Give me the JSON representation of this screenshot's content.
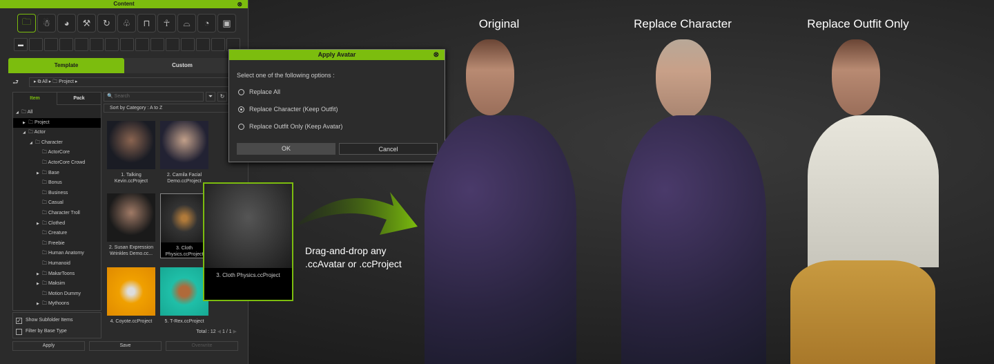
{
  "panel": {
    "title": "Content",
    "close_icon": "close-circle-icon",
    "category_icons": [
      "folder-icon",
      "actor-icon",
      "morph-icon",
      "tools-icon",
      "motion-icon",
      "cloth-icon",
      "accessory-icon",
      "pose-icon",
      "stage-icon",
      "scene-icon",
      "material-icon"
    ],
    "tabs": [
      "Template",
      "Custom"
    ],
    "breadcrumb": [
      "All",
      "Project"
    ],
    "tree_tabs": [
      "Item",
      "Pack"
    ],
    "tree": [
      {
        "label": "All",
        "level": 0,
        "arrow": "down"
      },
      {
        "label": "Project",
        "level": 1,
        "arrow": "right",
        "selected": true
      },
      {
        "label": "Actor",
        "level": 1,
        "arrow": "down"
      },
      {
        "label": "Character",
        "level": 2,
        "arrow": "down"
      },
      {
        "label": "ActorCore",
        "level": 3
      },
      {
        "label": "ActorCore Crowd",
        "level": 3
      },
      {
        "label": "Base",
        "level": 3,
        "arrow": "right"
      },
      {
        "label": "Bonus",
        "level": 3
      },
      {
        "label": "Business",
        "level": 3
      },
      {
        "label": "Casual",
        "level": 3
      },
      {
        "label": "Character Troll",
        "level": 3
      },
      {
        "label": "Clothed",
        "level": 3,
        "arrow": "right"
      },
      {
        "label": "Creature",
        "level": 3
      },
      {
        "label": "Freebie",
        "level": 3
      },
      {
        "label": "Human Anatomy",
        "level": 3
      },
      {
        "label": "Humanoid",
        "level": 3
      },
      {
        "label": "MakarToons",
        "level": 3,
        "arrow": "right"
      },
      {
        "label": "Maksim",
        "level": 3,
        "arrow": "right"
      },
      {
        "label": "Motion Dummy",
        "level": 3
      },
      {
        "label": "Mythoons",
        "level": 3,
        "arrow": "right"
      }
    ],
    "options": [
      {
        "label": "Show Subfolder Items",
        "checked": true
      },
      {
        "label": "Filter by Base Type",
        "checked": false
      }
    ],
    "search_placeholder": "Search",
    "sort": "Sort by Category : A to Z",
    "thumbnails": [
      {
        "line1": "1. Talking",
        "line2": "Kevin.ccProject"
      },
      {
        "line1": "2. Camila Facial",
        "line2": "Demo.ccProject"
      },
      {
        "line1": "2. Susan Expression",
        "line2": "Wrinkles Demo.cc..."
      },
      {
        "line1": "3. Cloth",
        "line2": "Physics.ccProject"
      },
      {
        "line1": "4. Coyote.ccProject",
        "line2": ""
      },
      {
        "line1": "5. T-Rex.ccProject",
        "line2": ""
      }
    ],
    "total": "Total : 12",
    "page": "1",
    "pages": "1",
    "buttons": {
      "apply": "Apply",
      "save": "Save",
      "overwrite": "Overwrite"
    }
  },
  "dialog": {
    "title": "Apply Avatar",
    "prompt": "Select one of the following options :",
    "options": [
      "Replace All",
      "Replace Character (Keep Outfit)",
      "Replace Outfit Only (Keep Avatar)"
    ],
    "selected_index": 1,
    "ok": "OK",
    "cancel": "Cancel"
  },
  "drag_preview": {
    "caption": "3. Cloth Physics.ccProject"
  },
  "drag_text": {
    "line1": "Drag-and-drop any",
    "line2": ".ccAvatar or .ccProject"
  },
  "labels": [
    "Original",
    "Replace Character",
    "Replace Outfit Only"
  ],
  "colors": {
    "accent": "#7cbd0e",
    "background": "#2b2b2b"
  }
}
